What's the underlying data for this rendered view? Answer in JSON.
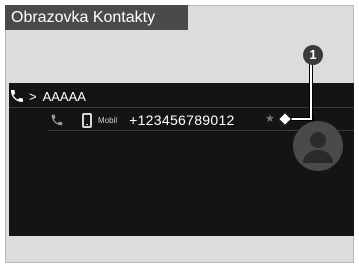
{
  "title": "Obrazovka Kontakty",
  "contact": {
    "name": "AAAAA",
    "phone_type": "Mobil",
    "number": "+123456789012"
  },
  "callout": {
    "number": "1"
  },
  "icons": {
    "header_phone": "phone-icon",
    "header_chevron": "chevron-right-icon",
    "entry_phone": "phone-icon",
    "entry_mobile": "mobile-phone-icon",
    "favorite": "star-icon",
    "avatar": "contact-avatar-icon"
  },
  "colors": {
    "screen_bg": "#141414",
    "title_bg": "#4a4a4a",
    "frame_bg": "#dcdcdc"
  }
}
